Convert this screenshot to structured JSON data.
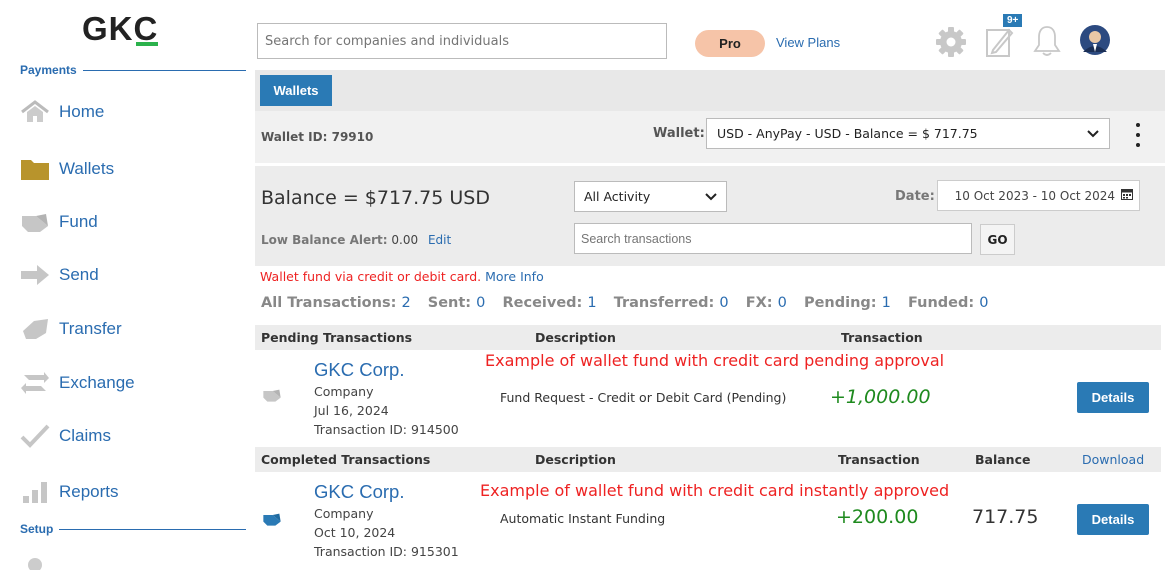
{
  "brand": {
    "logo": "GKC"
  },
  "colors": {
    "accent": "#2a7ab5",
    "link": "#2a6cb0",
    "gold": "#b8942c",
    "positive": "#1e8a1e",
    "alert": "#e22222",
    "pro": "#f6c4a8"
  },
  "sidebar": {
    "payments_label": "Payments",
    "setup_label": "Setup",
    "items": [
      {
        "label": "Home",
        "icon": "home-icon"
      },
      {
        "label": "Wallets",
        "icon": "folder-icon"
      },
      {
        "label": "Fund",
        "icon": "fund-icon"
      },
      {
        "label": "Send",
        "icon": "arrow-right-icon"
      },
      {
        "label": "Transfer",
        "icon": "transfer-icon"
      },
      {
        "label": "Exchange",
        "icon": "exchange-icon"
      },
      {
        "label": "Claims",
        "icon": "check-icon"
      },
      {
        "label": "Reports",
        "icon": "bar-chart-icon"
      }
    ]
  },
  "topbar": {
    "search_placeholder": "Search for companies and individuals",
    "pro_label": "Pro",
    "view_plans": "View Plans",
    "notification_badge": "9+"
  },
  "wallet": {
    "tab": "Wallets",
    "id_text": "Wallet ID: 79910",
    "select_label": "Wallet:",
    "selected": "USD - AnyPay - USD - Balance = $ 717.75",
    "balance": "Balance = $717.75 USD",
    "activity_filter": "All Activity",
    "date_label": "Date:",
    "date_range": "10 Oct 2023 - 10 Oct 2024",
    "low_balance_label": "Low Balance Alert:",
    "low_balance_value": "0.00",
    "edit": "Edit",
    "search_placeholder": "Search transactions",
    "go": "GO",
    "fund_note": "Wallet fund via credit or debit card.",
    "more_info": "More Info"
  },
  "counts": [
    {
      "label": "All Transactions:",
      "value": "2"
    },
    {
      "label": "Sent:",
      "value": "0"
    },
    {
      "label": "Received:",
      "value": "1"
    },
    {
      "label": "Transferred:",
      "value": "0"
    },
    {
      "label": "FX:",
      "value": "0"
    },
    {
      "label": "Pending:",
      "value": "1"
    },
    {
      "label": "Funded:",
      "value": "0"
    }
  ],
  "pending": {
    "headers": {
      "title": "Pending Transactions",
      "description": "Description",
      "transaction": "Transaction"
    },
    "annotation": "Example of wallet fund with credit card pending approval",
    "row": {
      "name": "GKC Corp.",
      "type": "Company",
      "date": "Jul 16, 2024",
      "txid": "Transaction ID: 914500",
      "description": "Fund Request - Credit or Debit Card (Pending)",
      "amount": "+1,000.00",
      "details": "Details"
    }
  },
  "completed": {
    "headers": {
      "title": "Completed Transactions",
      "description": "Description",
      "transaction": "Transaction",
      "balance": "Balance",
      "download": "Download"
    },
    "annotation": "Example of wallet fund with credit card instantly approved",
    "row": {
      "name": "GKC Corp.",
      "type": "Company",
      "date": "Oct 10, 2024",
      "txid": "Transaction ID: 915301",
      "description": "Automatic Instant Funding",
      "amount": "+200.00",
      "balance": "717.75",
      "details": "Details"
    }
  }
}
